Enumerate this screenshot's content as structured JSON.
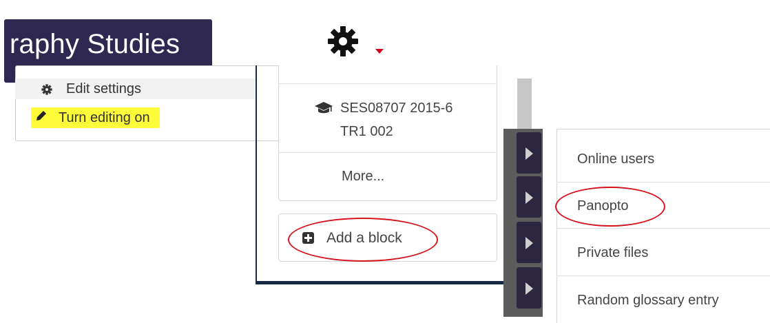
{
  "course": {
    "title": "raphy Studies"
  },
  "settings_menu": {
    "gear_icon": "gear-icon",
    "caret_color": "#d0021b",
    "items": [
      {
        "label": "Edit settings",
        "icon": "gear-icon"
      },
      {
        "label": "Turn editing on",
        "icon": "pencil-icon",
        "highlight": "#fffc3a"
      }
    ]
  },
  "navigation": {
    "course_code_line1": "SES08707 2015-6",
    "course_code_line2": "TR1 002",
    "course_icon": "graduation-cap-icon",
    "more_label": "More..."
  },
  "add_block": {
    "label": "Add a block",
    "icon": "plus-square-icon"
  },
  "block_list": {
    "items": [
      "Online users",
      "Panopto",
      "Private files",
      "Random glossary entry"
    ]
  },
  "colors": {
    "banner": "#2f2850",
    "annotation": "#d7131e",
    "highlight": "#fffc3a"
  }
}
